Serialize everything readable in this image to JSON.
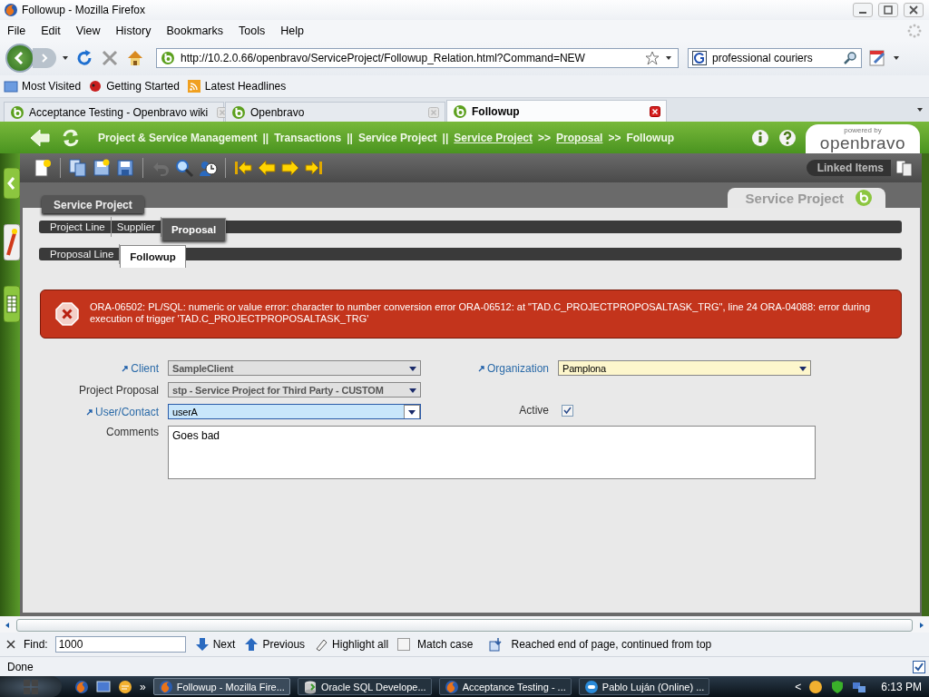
{
  "window": {
    "title": "Followup - Mozilla Firefox"
  },
  "menu": [
    "File",
    "Edit",
    "View",
    "History",
    "Bookmarks",
    "Tools",
    "Help"
  ],
  "address": {
    "value": "http://10.2.0.66/openbravo/ServiceProject/Followup_Relation.html?Command=NEW"
  },
  "search": {
    "value": "professional couriers"
  },
  "bookmarks": [
    {
      "label": "Most Visited",
      "kind": "folder"
    },
    {
      "label": "Getting Started",
      "kind": "page"
    },
    {
      "label": "Latest Headlines",
      "kind": "feed"
    }
  ],
  "browser_tabs": [
    {
      "label": "Acceptance Testing - Openbravo wiki",
      "selected": false
    },
    {
      "label": "Openbravo",
      "selected": false
    },
    {
      "label": "Followup",
      "selected": true
    }
  ],
  "breadcrumb": [
    {
      "kind": "text",
      "label": "Project & Service Management"
    },
    {
      "kind": "separator",
      "label": "||"
    },
    {
      "kind": "text",
      "label": "Transactions"
    },
    {
      "kind": "separator",
      "label": "||"
    },
    {
      "kind": "text",
      "label": "Service Project"
    },
    {
      "kind": "separator",
      "label": "||"
    },
    {
      "kind": "link",
      "label": "Service Project"
    },
    {
      "kind": "separator",
      "label": ">>"
    },
    {
      "kind": "link",
      "label": "Proposal"
    },
    {
      "kind": "separator",
      "label": ">>"
    },
    {
      "kind": "text",
      "label": "Followup"
    }
  ],
  "logo": {
    "caption": "powered by",
    "name": "openbravo"
  },
  "toolbar": [
    {
      "kind": "new",
      "disabled": false
    },
    {
      "kind": "sep"
    },
    {
      "kind": "copy",
      "disabled": false
    },
    {
      "kind": "save-new",
      "disabled": false
    },
    {
      "kind": "save",
      "disabled": false
    },
    {
      "kind": "sep"
    },
    {
      "kind": "undo",
      "disabled": true
    },
    {
      "kind": "search",
      "disabled": false
    },
    {
      "kind": "audit",
      "disabled": false
    },
    {
      "kind": "sep"
    },
    {
      "kind": "first",
      "disabled": false
    },
    {
      "kind": "previous",
      "disabled": false
    },
    {
      "kind": "next",
      "disabled": false
    },
    {
      "kind": "last",
      "disabled": false
    }
  ],
  "linked_items": {
    "label": "Linked Items"
  },
  "window_tab": {
    "label": "Service Project"
  },
  "level_tabs": [
    {
      "label": "Service Project",
      "selected": true
    }
  ],
  "tab_rows": [
    [
      {
        "label": "Project Line",
        "selected": false
      },
      {
        "label": "Supplier",
        "selected": false
      },
      {
        "label": "Proposal",
        "selected": true
      }
    ],
    [
      {
        "label": "Proposal Line",
        "selected": false
      },
      {
        "label": "Followup",
        "selected": true
      }
    ]
  ],
  "error": {
    "message": "ORA-06502: PL/SQL: numeric or value error: character to number conversion error ORA-06512: at \"TAD.C_PROJECTPROPOSALTASK_TRG\", line 24 ORA-04088: error during execution of trigger 'TAD.C_PROJECTPROPOSALTASK_TRG'"
  },
  "form_rows": [
    [
      {
        "label": "Client",
        "kind": "select",
        "linked": true,
        "value": "SampleClient",
        "readonly": true,
        "required": false,
        "focused": false
      },
      {
        "label": "Organization",
        "kind": "select",
        "linked": true,
        "value": "Pamplona",
        "readonly": false,
        "required": true,
        "focused": false
      }
    ],
    [
      {
        "label": "Project Proposal",
        "kind": "select",
        "linked": false,
        "value": "stp - Service Project for Third Party - CUSTOM",
        "readonly": true,
        "required": false,
        "focused": false
      }
    ],
    [
      {
        "label": "User/Contact",
        "kind": "select",
        "linked": true,
        "value": "userA",
        "readonly": false,
        "required": false,
        "focused": true
      },
      {
        "label": "Active",
        "kind": "checkbox",
        "linked": false,
        "checked": true
      }
    ],
    [
      {
        "label": "Comments",
        "kind": "textarea",
        "linked": false,
        "value": "Goes bad"
      }
    ]
  ],
  "find_bar": {
    "label": "Find:",
    "value": "1000",
    "next": "Next",
    "previous": "Previous",
    "highlight": "Highlight all",
    "match_case": {
      "label": "Match case",
      "checked": false
    },
    "message": "Reached end of page, continued from top"
  },
  "status_bar": {
    "text": "Done"
  },
  "taskbar": {
    "tasks": [
      {
        "label": "Followup - Mozilla Fire...",
        "kind": "firefox",
        "selected": true
      },
      {
        "label": "Oracle SQL Develope...",
        "kind": "oracle",
        "selected": false
      },
      {
        "label": "Acceptance Testing - ...",
        "kind": "firefox",
        "selected": false
      },
      {
        "label": "Pablo Luján (Online) ...",
        "kind": "chat",
        "selected": false
      }
    ],
    "overflow": "»",
    "tray_arrow": "<",
    "clock": "6:13 PM"
  }
}
